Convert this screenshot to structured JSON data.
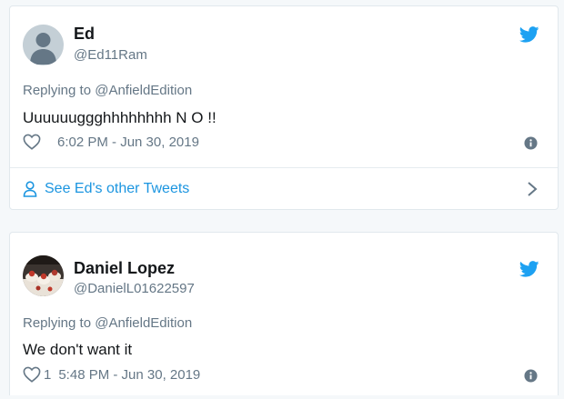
{
  "tweets": [
    {
      "name": "Ed",
      "handle": "@Ed11Ram",
      "replying": "Replying to @AnfieldEdition",
      "text": "Uuuuuuggghhhhhhhh N O !!",
      "likes": "",
      "timestamp": "6:02 PM - Jun 30, 2019",
      "avatar": "default-avatar-icon"
    },
    {
      "name": "Daniel Lopez",
      "handle": "@DanielL01622597",
      "replying": "Replying to @AnfieldEdition",
      "text": "We don't want it",
      "likes": "1",
      "timestamp": "5:48 PM - Jun 30, 2019",
      "avatar": "food-photo-avatar"
    }
  ],
  "see_other": {
    "label": "See Ed's other Tweets"
  },
  "colors": {
    "accent": "#1da1f2",
    "link": "#1b95e0",
    "muted": "#657786",
    "text": "#14171a"
  }
}
